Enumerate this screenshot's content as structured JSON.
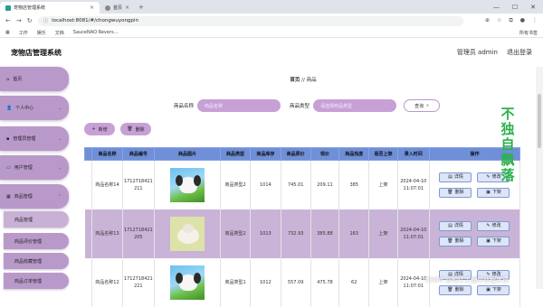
{
  "browser": {
    "tabs": [
      {
        "label": "宠物店管理系统"
      },
      {
        "label": "首页"
      }
    ],
    "url": "localhost:8081/#/chongwuyongpin",
    "bookmarks": [
      "工作",
      "娱乐",
      "文档",
      "SauceNAO Revers..."
    ],
    "bookmarks_right": "所有书签"
  },
  "header": {
    "title": "宠物店管理系统",
    "user": "管理员 admin",
    "logout": "退出登录"
  },
  "sidebar": {
    "items": [
      {
        "label": "首页",
        "icon": "home-icon"
      },
      {
        "label": "个人中心",
        "icon": "user-icon"
      },
      {
        "label": "管理员管理",
        "icon": "admin-icon"
      },
      {
        "label": "用户管理",
        "icon": "users-icon"
      },
      {
        "label": "商品管理",
        "icon": "grid-icon"
      }
    ],
    "subitems": [
      {
        "label": "商品管理"
      },
      {
        "label": "商品评价管理"
      },
      {
        "label": "商品收藏管理"
      },
      {
        "label": "商品订单管理"
      }
    ]
  },
  "main": {
    "breadcrumb_home": "首页",
    "breadcrumb_sep": "//",
    "breadcrumb_current": "商品",
    "search": {
      "name_label": "商品名称",
      "name_placeholder": "商品名称",
      "type_label": "商品类型",
      "type_placeholder": "请选择商品类型",
      "query": "查询"
    },
    "actions": {
      "add": "新增",
      "delete": "删除"
    },
    "columns": [
      "",
      "商品名称",
      "商品编号",
      "商品图片",
      "商品类型",
      "商品库存",
      "商品原价",
      "现价",
      "商品热度",
      "是否上架",
      "录入时间",
      "操作"
    ],
    "rows": [
      {
        "name": "商品名称14",
        "code": "1712718421211",
        "type": "商品类型2",
        "stock": "1014",
        "orig": "745.01",
        "price": "209.11",
        "heat": "385",
        "shelf": "上架",
        "time": "2024-04-10 11:07:01"
      },
      {
        "name": "商品名称13",
        "code": "1712718421205",
        "type": "商品类型2",
        "stock": "1013",
        "orig": "732.93",
        "price": "385.88",
        "heat": "163",
        "shelf": "上架",
        "time": "2024-04-10 11:07:01"
      },
      {
        "name": "商品名称12",
        "code": "1712718421221",
        "type": "商品类型1",
        "stock": "1012",
        "orig": "557.09",
        "price": "475.78",
        "heat": "62",
        "shelf": "上架",
        "time": "2024-04-10 11:07:01"
      }
    ],
    "row_ops": {
      "detail": "详情",
      "edit": "修改",
      "delete": "删除",
      "offshelf": "下架"
    }
  },
  "watermark": "不独自飘落",
  "watermark2": "CSDN @软件工程毕业程序员",
  "colors": {
    "accent": "#b999c9",
    "table_header": "#6f8fd8",
    "highlight_row": "#c9b3d6",
    "watermark": "#2bb24c"
  }
}
